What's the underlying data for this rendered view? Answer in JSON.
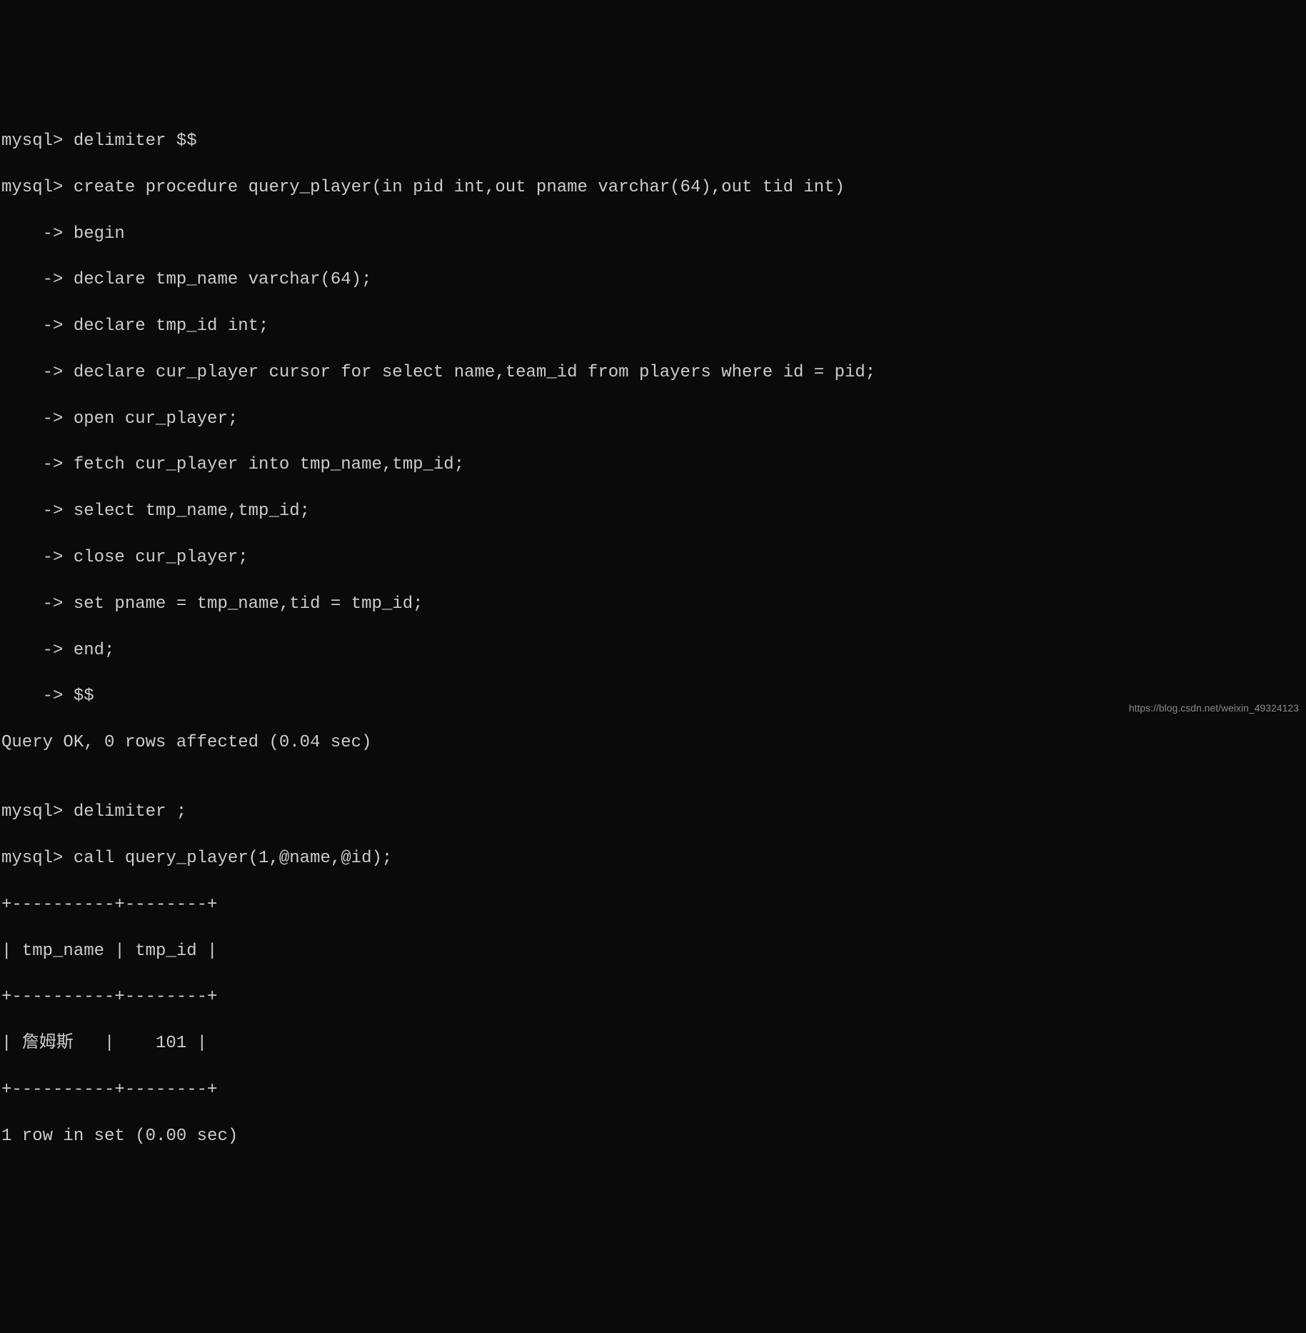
{
  "terminal": {
    "lines": [
      "mysql> delimiter $$",
      "mysql> create procedure query_player(in pid int,out pname varchar(64),out tid int)",
      "    -> begin",
      "    -> declare tmp_name varchar(64);",
      "    -> declare tmp_id int;",
      "    -> declare cur_player cursor for select name,team_id from players where id = pid;",
      "    -> open cur_player;",
      "    -> fetch cur_player into tmp_name,tmp_id;",
      "    -> select tmp_name,tmp_id;",
      "    -> close cur_player;",
      "    -> set pname = tmp_name,tid = tmp_id;",
      "    -> end;",
      "    -> $$",
      "Query OK, 0 rows affected (0.04 sec)",
      "",
      "mysql> delimiter ;",
      "mysql> call query_player(1,@name,@id);",
      "+----------+--------+",
      "| tmp_name | tmp_id |",
      "+----------+--------+",
      "| 詹姆斯   |    101 |",
      "+----------+--------+",
      "1 row in set (0.00 sec)"
    ]
  },
  "watermark": "https://blog.csdn.net/weixin_49324123"
}
